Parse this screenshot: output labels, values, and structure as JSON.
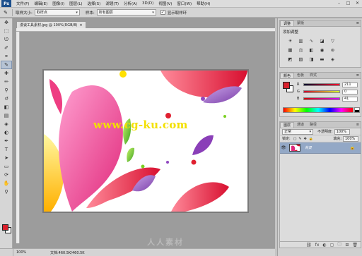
{
  "app": {
    "logo": "Ps",
    "menus": [
      "文件(F)",
      "编辑(E)",
      "图像(I)",
      "图层(L)",
      "选择(S)",
      "滤镜(T)",
      "分析(A)",
      "3D(D)",
      "视图(V)",
      "窗口(W)",
      "帮助(H)"
    ],
    "window_controls": [
      "–",
      "□",
      "✕"
    ]
  },
  "options": {
    "size_label": "取样大小:",
    "size_value": "取样点",
    "sample_label": "样本:",
    "sample_value": "所有图层",
    "ring_label": "显示取样环"
  },
  "document": {
    "tab_title": "漫谈工具素材.jpg @ 100%(RGB/8)",
    "close": "×",
    "watermark_text": "www.cg-ku.com"
  },
  "status": {
    "zoom": "100%",
    "doc_size": "文档:460.5K/460.5K"
  },
  "panels": {
    "adjust": {
      "tabs": [
        "调整",
        "蒙版"
      ],
      "title": "添加调整",
      "menu": "≡"
    },
    "color": {
      "tabs": [
        "颜色",
        "色板",
        "样式"
      ],
      "menu": "≡",
      "channels": [
        {
          "label": "R",
          "value": "211"
        },
        {
          "label": "G",
          "value": "0"
        },
        {
          "label": "B",
          "value": "41"
        }
      ],
      "fg": "#d3002c"
    },
    "layers": {
      "tabs": [
        "图层",
        "通道",
        "路径"
      ],
      "menu": "≡",
      "blend_mode": "正常",
      "opacity_label": "不透明度:",
      "opacity_value": "100%",
      "lock_label": "锁定:",
      "fill_label": "填充:",
      "fill_value": "100%",
      "layer_name": "背景",
      "foot_icons": [
        "⛓",
        "fx",
        "◐",
        "▢",
        "🗀",
        "⊞",
        "🗑"
      ]
    }
  },
  "site_watermark": "人人素材"
}
